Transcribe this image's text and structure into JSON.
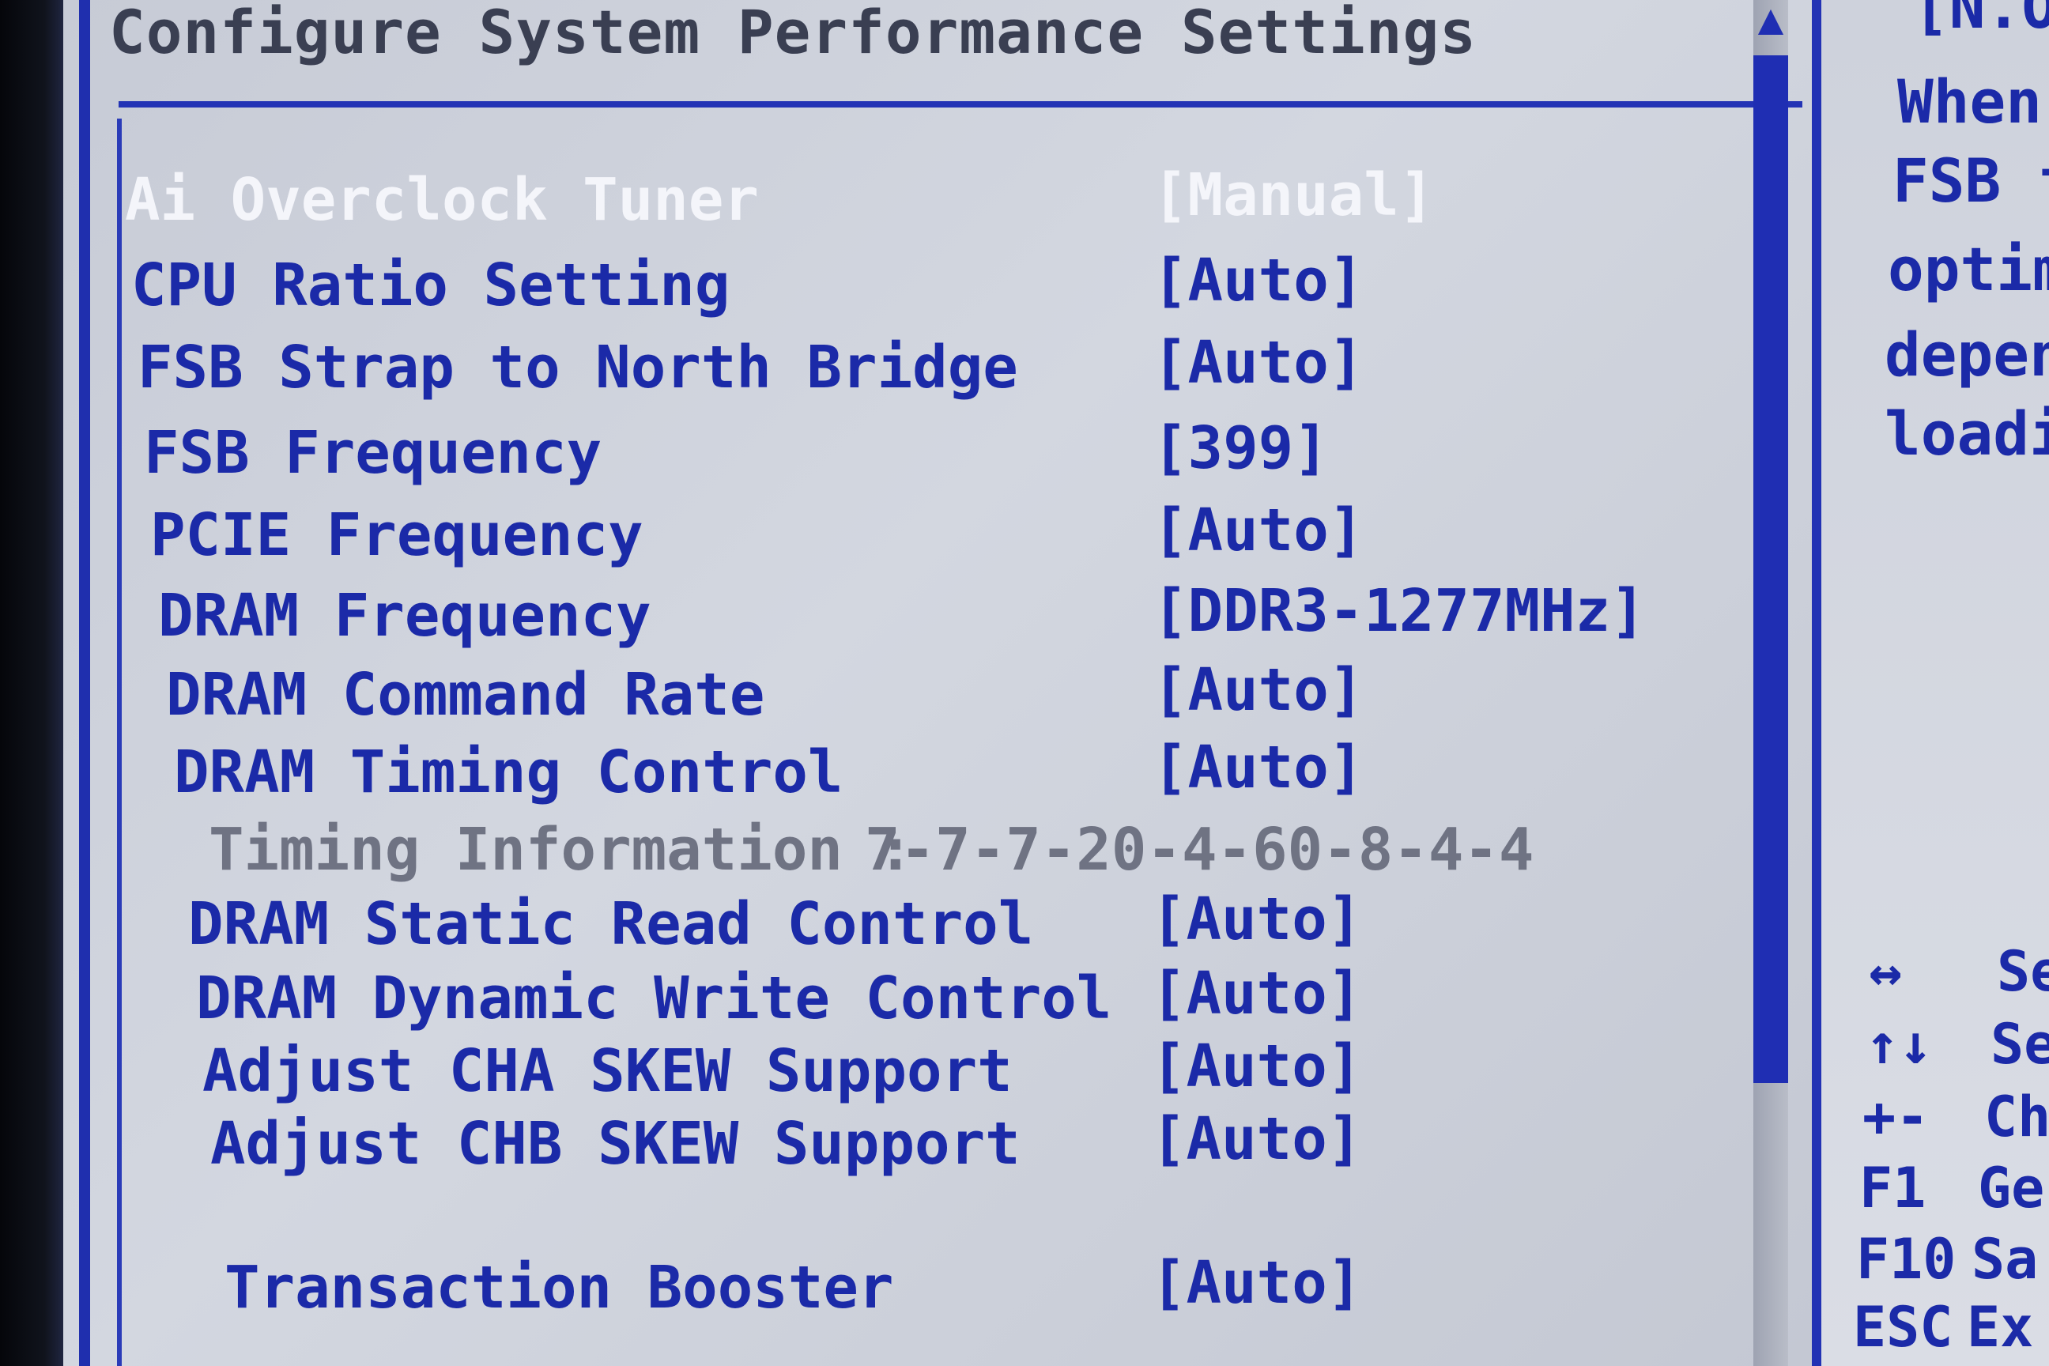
{
  "panel": {
    "title": "Configure System Performance Settings"
  },
  "settings": [
    {
      "label": "Ai Overclock Tuner",
      "value": "[Manual]"
    },
    {
      "label": "CPU Ratio Setting",
      "value": "[Auto]"
    },
    {
      "label": "FSB Strap to North Bridge",
      "value": "[Auto]"
    },
    {
      "label": "FSB Frequency",
      "value": "[399]"
    },
    {
      "label": "PCIE Frequency",
      "value": "[Auto]"
    },
    {
      "label": "DRAM Frequency",
      "value": "[DDR3-1277MHz]"
    },
    {
      "label": "DRAM Command Rate",
      "value": "[Auto]"
    },
    {
      "label": "DRAM Timing Control",
      "value": "[Auto]"
    },
    {
      "label": "Timing Information :",
      "value": "7-7-7-20-4-60-8-4-4"
    },
    {
      "label": "DRAM Static Read Control",
      "value": "[Auto]"
    },
    {
      "label": "DRAM Dynamic Write Control",
      "value": "[Auto]"
    },
    {
      "label": "Adjust CHA SKEW Support",
      "value": "[Auto]"
    },
    {
      "label": "Adjust CHB SKEW Support",
      "value": "[Auto]"
    },
    {
      "label": "Transaction Booster",
      "value": "[Auto]"
    }
  ],
  "help": {
    "lines": [
      "[N.O",
      "When",
      "FSB f",
      "optim",
      "depend",
      "loadi"
    ]
  },
  "keys": [
    {
      "key": "↔",
      "desc": "Se"
    },
    {
      "key": "↑↓",
      "desc": "Se"
    },
    {
      "key": "+-",
      "desc": "Ch"
    },
    {
      "key": "F1",
      "desc": "Ge"
    },
    {
      "key": "F10",
      "desc": "Sa"
    },
    {
      "key": "ESC",
      "desc": "Ex"
    }
  ],
  "scrollbar": {
    "up_arrow": "▲"
  },
  "colors": {
    "panel_bg": "#cfd3dd",
    "setting_text": "#1b2aa8",
    "selected_text": "#f4f5fa",
    "info_text": "#6f7383",
    "frame_blue": "#2333b5"
  }
}
